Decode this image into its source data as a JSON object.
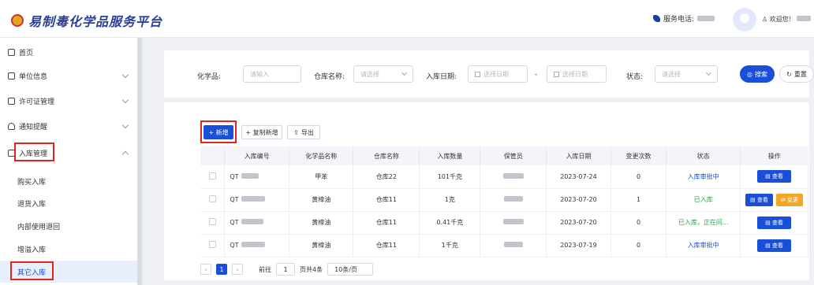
{
  "header": {
    "title": "易制毒化学品服务平台",
    "phone_label": "服务电话:",
    "welcome": "欢迎您！"
  },
  "sidebar": {
    "items": [
      {
        "label": "首页"
      },
      {
        "label": "单位信息"
      },
      {
        "label": "许可证管理"
      },
      {
        "label": "通知提醒"
      },
      {
        "label": "入库管理"
      }
    ],
    "submenu": [
      {
        "label": "购买入库"
      },
      {
        "label": "退货入库"
      },
      {
        "label": "内部使用退回"
      },
      {
        "label": "增溢入库"
      },
      {
        "label": "其它入库"
      }
    ]
  },
  "filters": {
    "chem_label": "化学品:",
    "chem_placeholder": "请输入",
    "warehouse_label": "仓库名称:",
    "warehouse_placeholder": "请选择",
    "date_label": "入库日期:",
    "date_start_placeholder": "选择日期",
    "date_sep": "-",
    "date_end_placeholder": "选择日期",
    "status_label": "状态:",
    "status_placeholder": "请选择",
    "search_label": "搜索",
    "reset_label": "重置"
  },
  "toolbar": {
    "add_label": "+ 新增",
    "copy_add_label": "+ 复制新增",
    "export_label": "导出"
  },
  "table": {
    "headers": [
      "入库编号",
      "化学品名称",
      "仓库名称",
      "入库数量",
      "保管员",
      "入库日期",
      "变更次数",
      "状态",
      "操作"
    ],
    "rows": [
      {
        "id": "QT",
        "chem": "甲苯",
        "warehouse": "仓库22",
        "qty": "101千克",
        "date": "2023-07-24",
        "changes": "0",
        "status": "入库审批中",
        "status_color": "#1a4fd7",
        "actions": [
          "查看"
        ]
      },
      {
        "id": "QT",
        "chem": "黄樟油",
        "warehouse": "仓库11",
        "qty": "1克",
        "date": "2023-07-20",
        "changes": "1",
        "status": "已入库",
        "status_color": "#2ba24c",
        "actions": [
          "查看",
          "变更"
        ]
      },
      {
        "id": "QT",
        "chem": "黄樟油",
        "warehouse": "仓库11",
        "qty": "0.41千克",
        "date": "2023-07-20",
        "changes": "0",
        "status": "已入库，正在间...",
        "status_color": "#2ba24c",
        "actions": [
          "查看"
        ]
      },
      {
        "id": "QT",
        "chem": "黄樟油",
        "warehouse": "仓库11",
        "qty": "1千克",
        "date": "2023-07-19",
        "changes": "0",
        "status": "入库审批中",
        "status_color": "#1a4fd7",
        "actions": [
          "查看"
        ]
      }
    ]
  },
  "pagination": {
    "current_page": "1",
    "goto_label": "前往",
    "goto_value": "1",
    "total_label": "页共4条",
    "page_size": "10条/页"
  }
}
